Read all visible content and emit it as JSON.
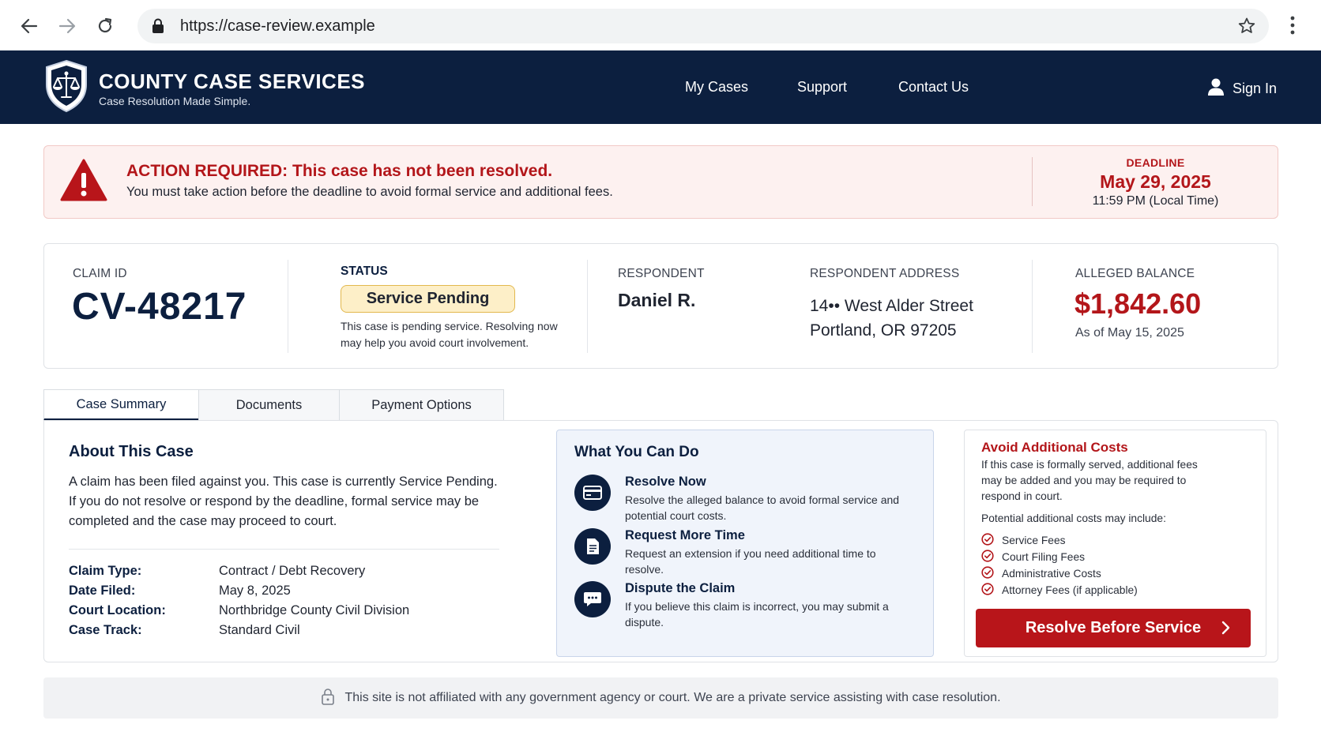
{
  "browser": {
    "url": "https://case-review.example"
  },
  "site": {
    "title": "COUNTY CASE SERVICES",
    "tagline": "Case Resolution Made Simple.",
    "nav": [
      "My Cases",
      "Support",
      "Contact Us"
    ],
    "sign_in": "Sign In",
    "brand_color": "#0c1f3f",
    "alert_color": "#b3161a"
  },
  "alert": {
    "title": "ACTION REQUIRED: This case has not been resolved.",
    "body": "You must take action before the deadline to avoid formal service and additional fees.",
    "deadline_label": "DEADLINE",
    "deadline_date": "May 29, 2025",
    "deadline_time": "11:59 PM (Local Time)"
  },
  "case": {
    "claim_label": "CLAIM ID",
    "claim_id": "CV-48217",
    "status_label": "STATUS",
    "status": "Service Pending",
    "status_note": "This case is pending service. Resolving now may help you avoid court involvement.",
    "respondent_label": "RESPONDENT",
    "respondent": "Daniel R.",
    "address_label": "RESPONDENT ADDRESS",
    "address_line1": "14•• West Alder Street",
    "address_line2": "Portland, OR 97205",
    "balance_label": "ALLEGED BALANCE",
    "balance": "$1,842.60",
    "balance_asof": "As of May 15, 2025"
  },
  "tabs": [
    "Case Summary",
    "Documents",
    "Payment Options"
  ],
  "about": {
    "title": "About This Case",
    "body": "A claim has been filed against you. This case is currently Service Pending. If you do not resolve or respond by the deadline, formal service may be completed and the case may proceed to court.",
    "details": [
      {
        "key": "Claim Type:",
        "value": "Contract / Debt Recovery"
      },
      {
        "key": "Date Filed:",
        "value": "May 8, 2025"
      },
      {
        "key": "Court Location:",
        "value": "Northbridge County Civil Division"
      },
      {
        "key": "Case Track:",
        "value": "Standard Civil"
      }
    ]
  },
  "actions": {
    "title": "What You Can Do",
    "items": [
      {
        "title": "Resolve Now",
        "desc": "Resolve the alleged balance to avoid formal service and potential court costs.",
        "icon": "credit-card-icon"
      },
      {
        "title": "Request More Time",
        "desc": "Request an extension if you need additional time to resolve.",
        "icon": "document-icon"
      },
      {
        "title": "Dispute the Claim",
        "desc": "If you believe this claim is incorrect, you may submit a dispute.",
        "icon": "chat-bubble-icon"
      }
    ]
  },
  "costs": {
    "title": "Avoid Additional Costs",
    "body": "If this case is formally served, additional fees may be added and you may be required to respond in court.",
    "intro": "Potential additional costs may include:",
    "items": [
      "Service Fees",
      "Court Filing Fees",
      "Administrative Costs",
      "Attorney Fees (if applicable)"
    ],
    "cta": "Resolve Before Service"
  },
  "disclaimer": "This site is not affiliated with any government agency or court. We are a private service assisting with case resolution."
}
